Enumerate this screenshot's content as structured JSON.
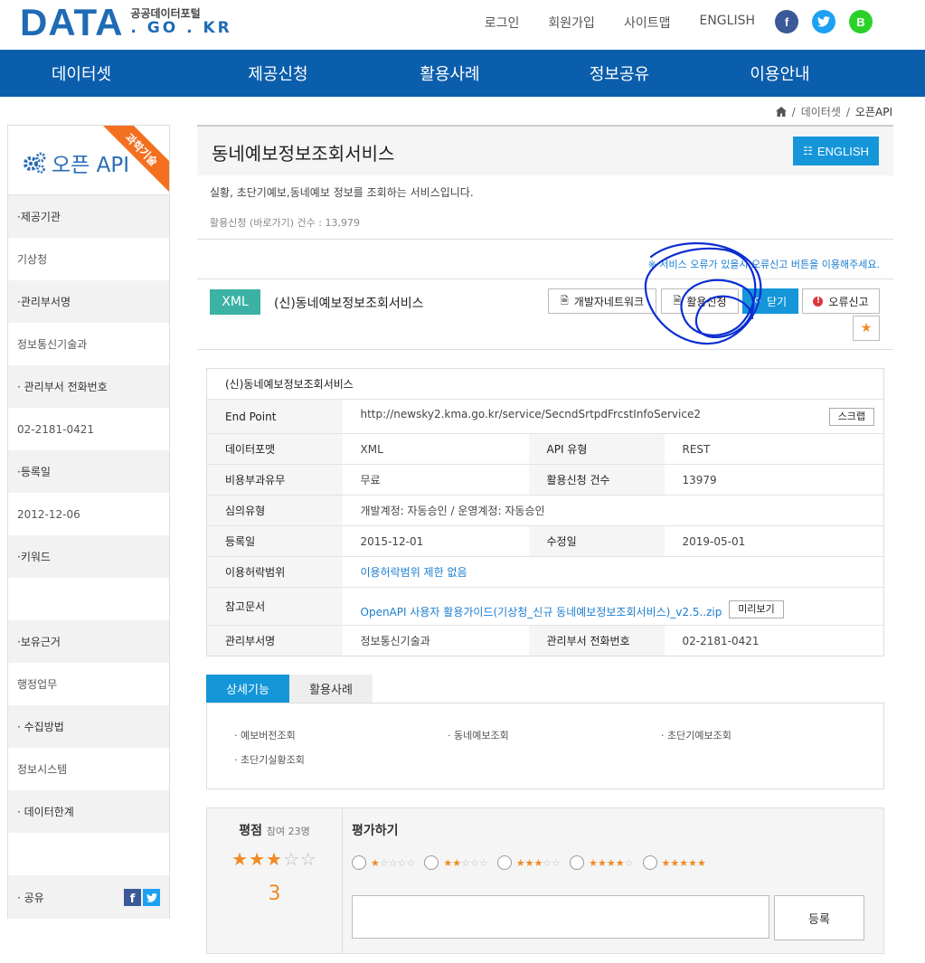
{
  "header": {
    "logo_main": "DATA",
    "logo_kr": "공공데이터포털",
    "logo_domain": ". GO . KR",
    "links": [
      "로그인",
      "회원가입",
      "사이트맵",
      "ENGLISH"
    ],
    "social": [
      {
        "name": "facebook-icon",
        "glyph": "f",
        "color": "#3b5998"
      },
      {
        "name": "twitter-icon",
        "glyph": "t",
        "color": "#1da1f2"
      },
      {
        "name": "band-icon",
        "glyph": "B",
        "color": "#2bd12b"
      }
    ]
  },
  "nav": [
    "데이터셋",
    "제공신청",
    "활용사례",
    "정보공유",
    "이용안내"
  ],
  "breadcrumb": {
    "home_icon": "home-icon",
    "items": [
      "데이터셋",
      "오픈API"
    ]
  },
  "sidebar": {
    "title": "오픈 API",
    "ribbon": "과학기술",
    "rows": [
      {
        "label": "·제공기관",
        "value": "기상청"
      },
      {
        "label": "·관리부서명",
        "value": "정보통신기술과"
      },
      {
        "label": "· 관리부서 전화번호",
        "value": "02-2181-0421"
      },
      {
        "label": "·등록일",
        "value": "2012-12-06"
      },
      {
        "label": "·키워드",
        "value": ""
      },
      {
        "label": "·보유근거",
        "value": "행정업무"
      },
      {
        "label": "· 수집방법",
        "value": "정보시스템"
      },
      {
        "label": "· 데이터한계",
        "value": ""
      },
      {
        "label": "· 공유",
        "value": ""
      }
    ]
  },
  "main": {
    "title": "동네예보정보조회서비스",
    "english_btn": "ENGLISH",
    "description": "실황, 초단기예보,동네예보 정보를 조회하는 서비스입니다.",
    "apply_count": "활용신청 (바로가기) 건수 : 13,979",
    "notice": "※ 서비스 오류가 있을시 오류신고 버튼을 이용해주세요.",
    "format_badge": "XML",
    "service_name": "(신)동네예보정보조회서비스",
    "buttons": {
      "dev_network": "개발자네트워크",
      "apply": "활용신청",
      "close": "닫기",
      "error_report": "오류신고"
    }
  },
  "info_table": {
    "caption": "(신)동네예보정보조회서비스",
    "endpoint_label": "End Point",
    "endpoint": "http://newsky2.kma.go.kr/service/SecndSrtpdFrcstInfoService2",
    "scrap_btn": "스크랩",
    "format_label": "데이터포맷",
    "format": "XML",
    "api_type_label": "API 유형",
    "api_type": "REST",
    "fee_label": "비용부과유무",
    "fee": "무료",
    "apply_count_label": "활용신청 건수",
    "apply_count": "13979",
    "review_label": "심의유형",
    "review": "개발계정: 자동승인 / 운영계정: 자동승인",
    "reg_label": "등록일",
    "reg": "2015-12-01",
    "mod_label": "수정일",
    "mod": "2019-05-01",
    "scope_label": "이용허락범위",
    "scope": "이용허락범위 제한 없음",
    "doc_label": "참고문서",
    "doc": "OpenAPI 사용자 활용가이드(기상청_신규 동네예보정보조회서비스)_v2.5..zip",
    "preview_btn": "미리보기",
    "dept_label": "관리부서명",
    "dept": "정보통신기술과",
    "phone_label": "관리부서 전화번호",
    "phone": "02-2181-0421"
  },
  "tabs": [
    "상세기능",
    "활용사례"
  ],
  "features": [
    "· 예보버전조회",
    "· 동네예보조회",
    "· 초단기예보조회",
    "· 초단기실황조회"
  ],
  "rating": {
    "label": "평점",
    "participants": "참여 23명",
    "score": "3",
    "score_value": 3,
    "max_stars": 5,
    "evaluate_label": "평가하기",
    "submit_btn": "등록"
  }
}
